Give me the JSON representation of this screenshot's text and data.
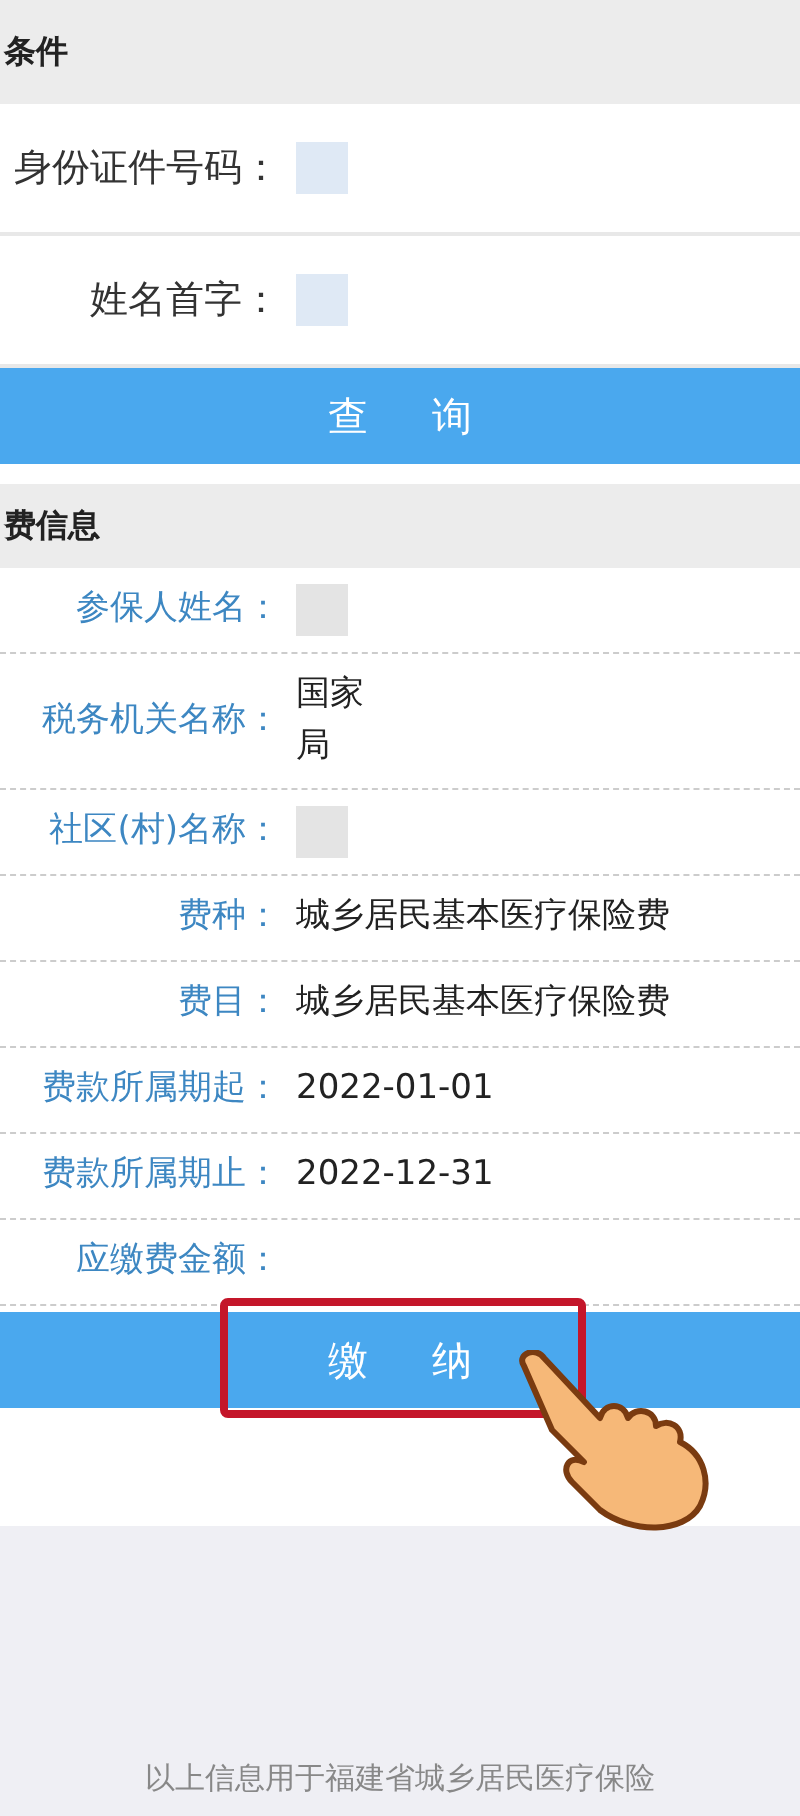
{
  "query_section": {
    "title": "条件",
    "fields": [
      {
        "label": "身份证件号码："
      },
      {
        "label": "姓名首字："
      }
    ],
    "button": "查询"
  },
  "payment_section": {
    "title": "费信息",
    "rows": [
      {
        "label": "参保人姓名：",
        "kind": "redacted"
      },
      {
        "label": "税务机关名称：",
        "kind": "text",
        "value_lines": [
          "国家",
          "局"
        ]
      },
      {
        "label": "社区(村)名称：",
        "kind": "redacted"
      },
      {
        "label": "费种：",
        "kind": "text",
        "value_lines": [
          "城乡居民基本医疗保险费"
        ]
      },
      {
        "label": "费目：",
        "kind": "text",
        "value_lines": [
          "城乡居民基本医疗保险费"
        ]
      },
      {
        "label": "费款所属期起：",
        "kind": "text",
        "value_lines": [
          "2022-01-01"
        ]
      },
      {
        "label": "费款所属期止：",
        "kind": "text",
        "value_lines": [
          "2022-12-31"
        ]
      },
      {
        "label": "应缴费金额：",
        "kind": "empty"
      }
    ],
    "button": {
      "label": "缴纳",
      "highlighted": true
    }
  },
  "footer": "以上信息用于福建省城乡居民医疗保险"
}
